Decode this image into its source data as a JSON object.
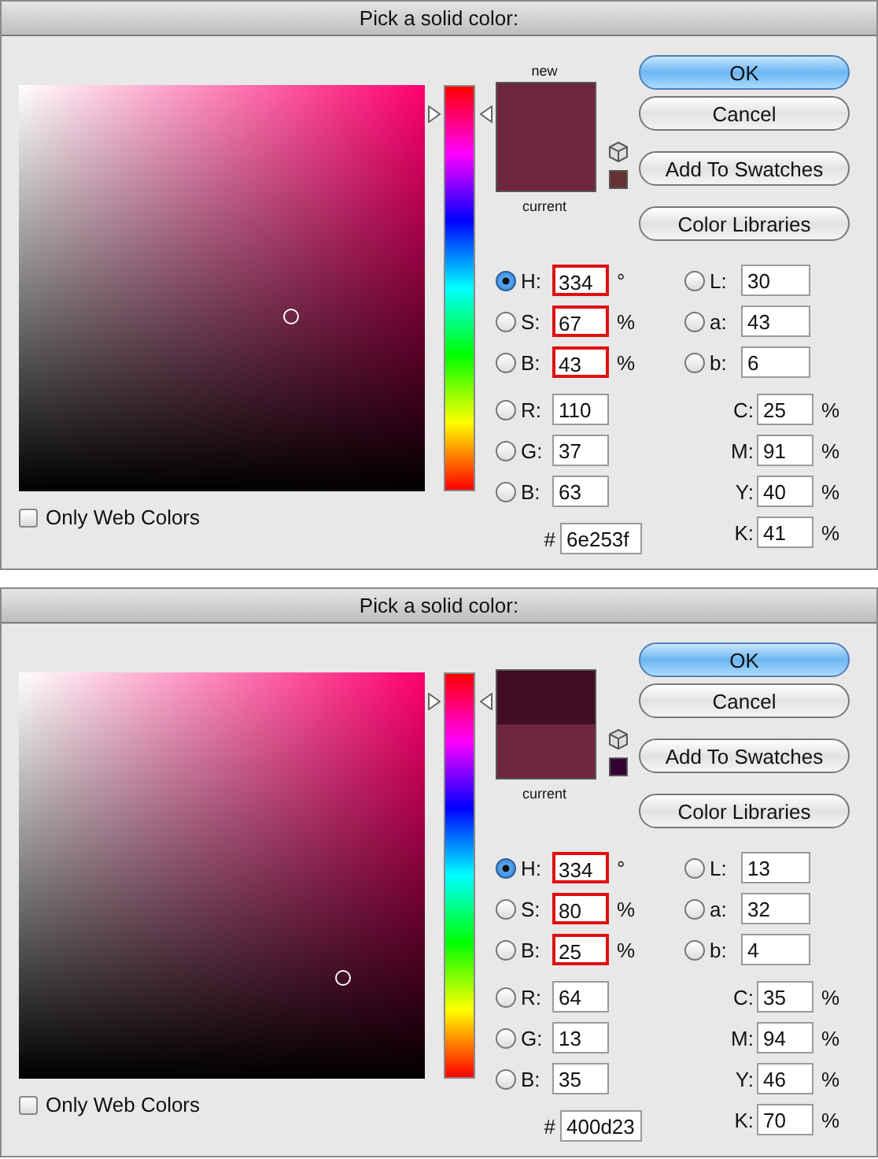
{
  "dialogs": [
    {
      "title": "Pick a solid color:",
      "web_only": {
        "label": "Only Web Colors",
        "checked": false
      },
      "hue_slider": {
        "level": 0.928
      },
      "swatch": {
        "new_label": "new",
        "current_label": "current",
        "new": {
          "color": "#6e253f"
        },
        "current": {
          "color": "#6e253f"
        },
        "websafe": {
          "color": "#663333"
        }
      },
      "buttons": [
        {
          "label": "OK",
          "default": true
        },
        {
          "label": "Cancel",
          "default": false
        },
        {
          "label": "Add To Swatches",
          "default": false
        },
        {
          "label": "Color Libraries",
          "default": false
        }
      ],
      "color_fields": [
        {
          "label": "H:",
          "value": "334",
          "unit": "°",
          "selected": true,
          "highlighted": true
        },
        {
          "label": "S:",
          "value": "67",
          "unit": "%",
          "selected": false,
          "highlighted": true
        },
        {
          "label": "B:",
          "value": "43",
          "unit": "%",
          "selected": false,
          "highlighted": true
        },
        {
          "label": "R:",
          "value": "110",
          "selected": false,
          "highlighted": false
        },
        {
          "label": "G:",
          "value": "37",
          "selected": false,
          "highlighted": false
        },
        {
          "label": "B:",
          "value": "63",
          "selected": false,
          "highlighted": false
        }
      ],
      "lab_fields": [
        {
          "label": "L:",
          "value": "30",
          "selected": false
        },
        {
          "label": "a:",
          "value": "43",
          "selected": false
        },
        {
          "label": "b:",
          "value": "6",
          "selected": false
        }
      ],
      "cmyk_fields": [
        {
          "label": "C:",
          "value": "25",
          "unit": "%"
        },
        {
          "label": "M:",
          "value": "91",
          "unit": "%"
        },
        {
          "label": "Y:",
          "value": "40",
          "unit": "%"
        },
        {
          "label": "K:",
          "value": "41",
          "unit": "%"
        }
      ],
      "hex": {
        "label": "#",
        "value": "6e253f"
      }
    },
    {
      "title": "Pick a solid color:",
      "web_only": {
        "label": "Only Web Colors",
        "checked": false
      },
      "hue_slider": {
        "level": 0.928
      },
      "swatch": {
        "current_label": "current",
        "new": {
          "color": "#400d23"
        },
        "current": {
          "color": "#6e253f"
        },
        "websafe": {
          "color": "#330033"
        }
      },
      "buttons": [
        {
          "label": "OK",
          "default": true
        },
        {
          "label": "Cancel",
          "default": false
        },
        {
          "label": "Add To Swatches",
          "default": false
        },
        {
          "label": "Color Libraries",
          "default": false
        }
      ],
      "color_fields": [
        {
          "label": "H:",
          "value": "334",
          "unit": "°",
          "selected": true,
          "highlighted": true
        },
        {
          "label": "S:",
          "value": "80",
          "unit": "%",
          "selected": false,
          "highlighted": true
        },
        {
          "label": "B:",
          "value": "25",
          "unit": "%",
          "selected": false,
          "highlighted": true
        },
        {
          "label": "R:",
          "value": "64",
          "selected": false,
          "highlighted": false
        },
        {
          "label": "G:",
          "value": "13",
          "selected": false,
          "highlighted": false
        },
        {
          "label": "B:",
          "value": "35",
          "selected": false,
          "highlighted": false
        }
      ],
      "lab_fields": [
        {
          "label": "L:",
          "value": "13",
          "selected": false
        },
        {
          "label": "a:",
          "value": "32",
          "selected": false
        },
        {
          "label": "b:",
          "value": "4",
          "selected": false
        }
      ],
      "cmyk_fields": [
        {
          "label": "C:",
          "value": "35",
          "unit": "%"
        },
        {
          "label": "M:",
          "value": "94",
          "unit": "%"
        },
        {
          "label": "Y:",
          "value": "46",
          "unit": "%"
        },
        {
          "label": "K:",
          "value": "70",
          "unit": "%"
        }
      ],
      "hex": {
        "label": "#",
        "value": "400d23"
      }
    }
  ]
}
